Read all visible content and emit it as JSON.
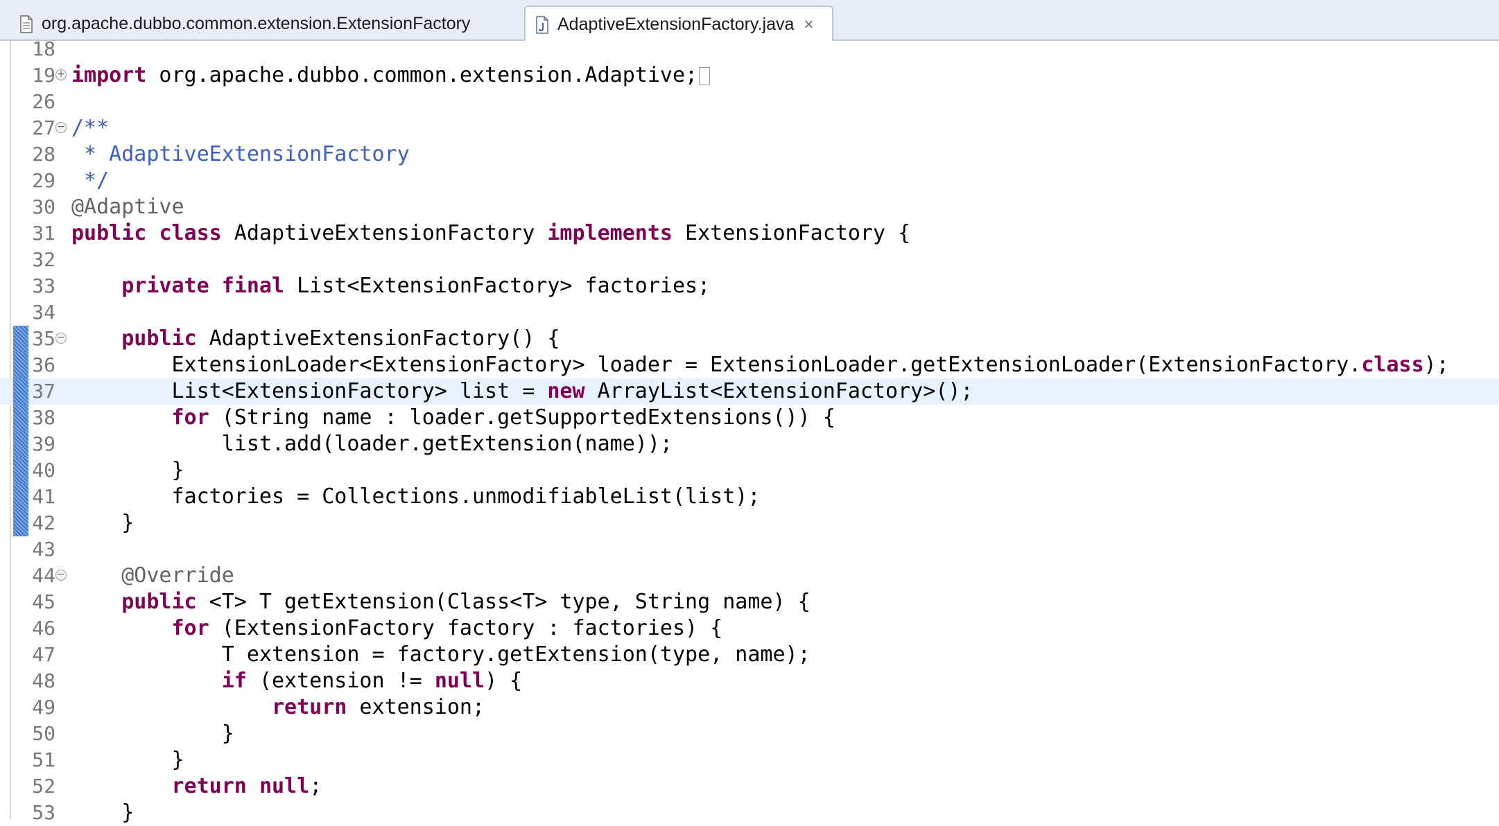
{
  "tabs": [
    {
      "label": "org.apache.dubbo.common.extension.ExtensionFactory",
      "active": false,
      "icon": "class-file-icon"
    },
    {
      "label": "AdaptiveExtensionFactory.java",
      "active": true,
      "icon": "java-file-icon",
      "close": "×"
    }
  ],
  "editor": {
    "current_line": "37",
    "lines": [
      {
        "num": "18"
      },
      {
        "num": "19",
        "fold": "+",
        "tokens": [
          {
            "t": "import",
            "c": "kw"
          },
          {
            "t": " org.apache.dubbo.common.extension.Adaptive;"
          }
        ],
        "collapsed": true
      },
      {
        "num": "26"
      },
      {
        "num": "27",
        "fold": "-",
        "tokens": [
          {
            "t": "/**",
            "c": "comment"
          }
        ]
      },
      {
        "num": "28",
        "tokens": [
          {
            "t": " * AdaptiveExtensionFactory",
            "c": "comment"
          }
        ]
      },
      {
        "num": "29",
        "tokens": [
          {
            "t": " */",
            "c": "comment"
          }
        ]
      },
      {
        "num": "30",
        "tokens": [
          {
            "t": "@Adaptive",
            "c": "ann"
          }
        ]
      },
      {
        "num": "31",
        "tokens": [
          {
            "t": "public",
            "c": "kw"
          },
          {
            "t": " "
          },
          {
            "t": "class",
            "c": "kw"
          },
          {
            "t": " AdaptiveExtensionFactory "
          },
          {
            "t": "implements",
            "c": "kw"
          },
          {
            "t": " ExtensionFactory {"
          }
        ]
      },
      {
        "num": "32"
      },
      {
        "num": "33",
        "tokens": [
          {
            "t": "    "
          },
          {
            "t": "private",
            "c": "kw"
          },
          {
            "t": " "
          },
          {
            "t": "final",
            "c": "kw"
          },
          {
            "t": " List<ExtensionFactory> factories;"
          }
        ]
      },
      {
        "num": "34"
      },
      {
        "num": "35",
        "fold": "-",
        "diff": true,
        "tokens": [
          {
            "t": "    "
          },
          {
            "t": "public",
            "c": "kw"
          },
          {
            "t": " AdaptiveExtensionFactory() {"
          }
        ]
      },
      {
        "num": "36",
        "diff": true,
        "tokens": [
          {
            "t": "        ExtensionLoader<ExtensionFactory> loader = ExtensionLoader.getExtensionLoader(ExtensionFactory."
          },
          {
            "t": "class",
            "c": "kw"
          },
          {
            "t": ");"
          }
        ]
      },
      {
        "num": "37",
        "diff": true,
        "tokens": [
          {
            "t": "        List<ExtensionFactory> list = "
          },
          {
            "t": "new",
            "c": "kw"
          },
          {
            "t": " ArrayList<ExtensionFactory>();"
          }
        ]
      },
      {
        "num": "38",
        "diff": true,
        "tokens": [
          {
            "t": "        "
          },
          {
            "t": "for",
            "c": "kw"
          },
          {
            "t": " (String name : loader.getSupportedExtensions()) {"
          }
        ]
      },
      {
        "num": "39",
        "diff": true,
        "tokens": [
          {
            "t": "            list.add(loader.getExtension(name));"
          }
        ]
      },
      {
        "num": "40",
        "diff": true,
        "tokens": [
          {
            "t": "        }"
          }
        ]
      },
      {
        "num": "41",
        "diff": true,
        "tokens": [
          {
            "t": "        factories = Collections.unmodifiableList(list);"
          }
        ]
      },
      {
        "num": "42",
        "diff": true,
        "tokens": [
          {
            "t": "    }"
          }
        ]
      },
      {
        "num": "43"
      },
      {
        "num": "44",
        "fold": "-",
        "tokens": [
          {
            "t": "    "
          },
          {
            "t": "@Override",
            "c": "ann"
          }
        ]
      },
      {
        "num": "45",
        "tokens": [
          {
            "t": "    "
          },
          {
            "t": "public",
            "c": "kw"
          },
          {
            "t": " <T> T getExtension(Class<T> type, String name) {"
          }
        ]
      },
      {
        "num": "46",
        "tokens": [
          {
            "t": "        "
          },
          {
            "t": "for",
            "c": "kw"
          },
          {
            "t": " (ExtensionFactory factory : factories) {"
          }
        ]
      },
      {
        "num": "47",
        "tokens": [
          {
            "t": "            T extension = factory.getExtension(type, name);"
          }
        ]
      },
      {
        "num": "48",
        "tokens": [
          {
            "t": "            "
          },
          {
            "t": "if",
            "c": "kw"
          },
          {
            "t": " (extension != "
          },
          {
            "t": "null",
            "c": "kw"
          },
          {
            "t": ") {"
          }
        ]
      },
      {
        "num": "49",
        "tokens": [
          {
            "t": "                "
          },
          {
            "t": "return",
            "c": "kw"
          },
          {
            "t": " extension;"
          }
        ]
      },
      {
        "num": "50",
        "tokens": [
          {
            "t": "            }"
          }
        ]
      },
      {
        "num": "51",
        "tokens": [
          {
            "t": "        }"
          }
        ]
      },
      {
        "num": "52",
        "tokens": [
          {
            "t": "        "
          },
          {
            "t": "return",
            "c": "kw"
          },
          {
            "t": " "
          },
          {
            "t": "null",
            "c": "kw"
          },
          {
            "t": ";"
          }
        ]
      },
      {
        "num": "53",
        "tokens": [
          {
            "t": "    }"
          }
        ]
      }
    ]
  }
}
